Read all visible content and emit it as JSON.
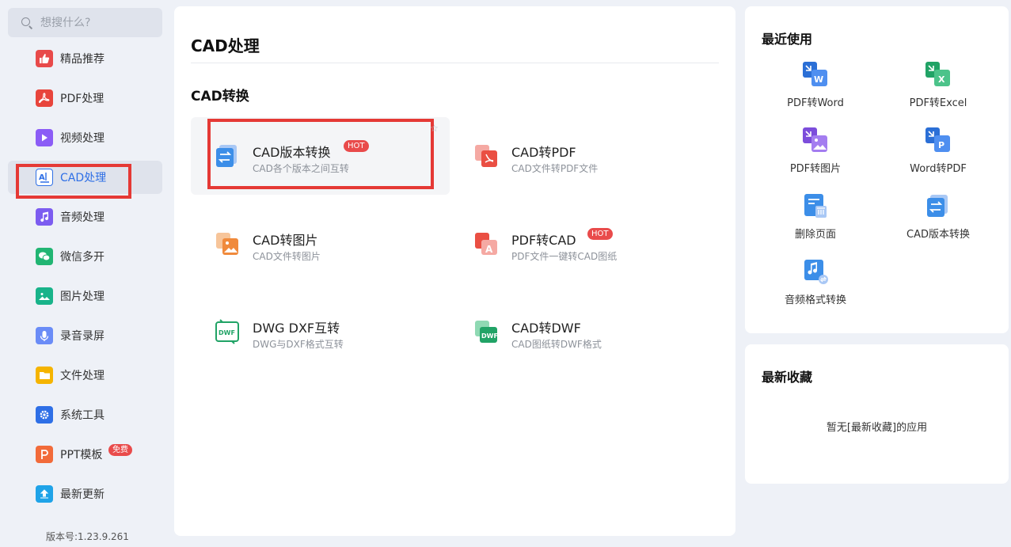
{
  "search": {
    "placeholder": "想搜什么?"
  },
  "sidebar": {
    "items": [
      {
        "label": "精品推荐",
        "icon": "thumbs-up-icon",
        "color": "#e84a4a"
      },
      {
        "label": "PDF处理",
        "icon": "pdf-icon",
        "color": "#e8453c"
      },
      {
        "label": "视频处理",
        "icon": "play-icon",
        "color": "#8b5cf6"
      },
      {
        "label": "CAD处理",
        "icon": "cad-icon",
        "color": "#2e6fe6"
      },
      {
        "label": "音频处理",
        "icon": "music-icon",
        "color": "#7c5cf0"
      },
      {
        "label": "微信多开",
        "icon": "wechat-icon",
        "color": "#21b573"
      },
      {
        "label": "图片处理",
        "icon": "image-icon",
        "color": "#18b38a"
      },
      {
        "label": "录音录屏",
        "icon": "microphone-icon",
        "color": "#6a8cf7"
      },
      {
        "label": "文件处理",
        "icon": "folder-icon",
        "color": "#f5b400"
      },
      {
        "label": "系统工具",
        "icon": "gear-icon",
        "color": "#2e6fe6"
      },
      {
        "label": "PPT模板",
        "icon": "ppt-icon",
        "color": "#f26b3a",
        "badge": "免费"
      },
      {
        "label": "最新更新",
        "icon": "upload-icon",
        "color": "#1fa3e8"
      }
    ],
    "version": "版本号:1.23.9.261"
  },
  "main": {
    "title": "CAD处理",
    "section": "CAD转换",
    "cards": [
      {
        "title": "CAD版本转换",
        "sub": "CAD各个版本之间互转",
        "hot": "HOT",
        "icon": "version-convert-icon"
      },
      {
        "title": "CAD转PDF",
        "sub": "CAD文件转PDF文件",
        "icon": "cad-to-pdf-icon"
      },
      {
        "title": "CAD转图片",
        "sub": "CAD文件转图片",
        "icon": "cad-to-image-icon"
      },
      {
        "title": "PDF转CAD",
        "sub": "PDF文件一键转CAD图纸",
        "hot": "HOT",
        "icon": "pdf-to-cad-icon"
      },
      {
        "title": "DWG DXF互转",
        "sub": "DWG与DXF格式互转",
        "icon": "dwg-dxf-icon"
      },
      {
        "title": "CAD转DWF",
        "sub": "CAD图纸转DWF格式",
        "icon": "cad-to-dwf-icon"
      }
    ]
  },
  "recent": {
    "title": "最近使用",
    "apps": [
      {
        "label": "PDF转Word",
        "icon": "pdf-to-word-icon",
        "color": "#2b6fd6"
      },
      {
        "label": "PDF转Excel",
        "icon": "pdf-to-excel-icon",
        "color": "#21a366"
      },
      {
        "label": "PDF转图片",
        "icon": "pdf-to-image-icon",
        "color": "#7c4ddb"
      },
      {
        "label": "Word转PDF",
        "icon": "word-to-pdf-icon",
        "color": "#2b6fd6"
      },
      {
        "label": "删除页面",
        "icon": "delete-page-icon",
        "color": "#3c8ee8"
      },
      {
        "label": "CAD版本转换",
        "icon": "cad-version-icon",
        "color": "#3c8ee8"
      },
      {
        "label": "音频格式转换",
        "icon": "audio-convert-icon",
        "color": "#3c8ee8"
      }
    ]
  },
  "favorites": {
    "title": "最新收藏",
    "empty": "暂无[最新收藏]的应用"
  }
}
